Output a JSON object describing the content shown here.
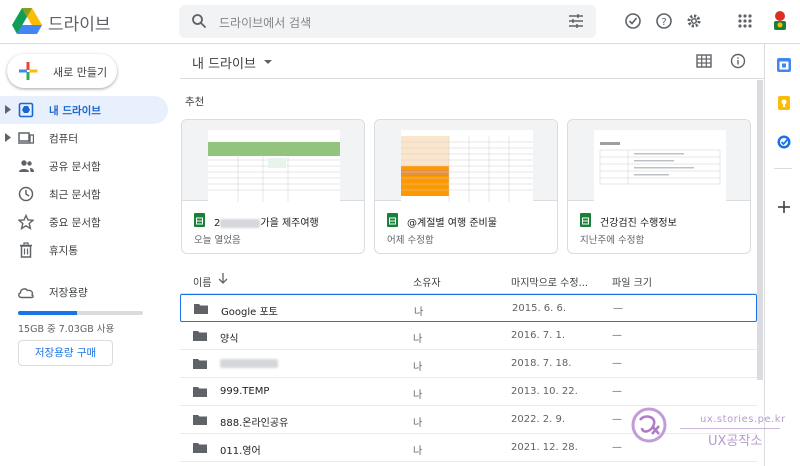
{
  "header": {
    "app_title": "드라이브",
    "search_placeholder": "드라이브에서 검색",
    "icons": [
      "search-icon",
      "tune-icon",
      "offline-check-icon",
      "help-icon",
      "settings-icon",
      "apps-grid-icon",
      "account-avatar"
    ]
  },
  "sidebar": {
    "new_button": "새로 만들기",
    "items": [
      {
        "label": "내 드라이브",
        "icon": "my-drive-icon",
        "active": true,
        "expandable": true
      },
      {
        "label": "컴퓨터",
        "icon": "computer-icon",
        "active": false,
        "expandable": true
      },
      {
        "label": "공유 문서함",
        "icon": "shared-people-icon",
        "active": false,
        "expandable": false
      },
      {
        "label": "최근 문서함",
        "icon": "clock-icon",
        "active": false,
        "expandable": false
      },
      {
        "label": "중요 문서함",
        "icon": "star-icon",
        "active": false,
        "expandable": false
      },
      {
        "label": "휴지통",
        "icon": "trash-icon",
        "active": false,
        "expandable": false
      }
    ],
    "storage": {
      "label": "저장용량",
      "usage_text": "15GB 중 7.03GB 사용",
      "used_fraction": 0.47,
      "buy_button": "저장용량 구매"
    }
  },
  "main": {
    "breadcrumb": "내 드라이브",
    "suggested_title": "추천",
    "cards": [
      {
        "name_prefix": "2",
        "name_suffix": "가을 제주여행",
        "meta": "오늘 열었음"
      },
      {
        "name_prefix": "@계절별 여행 준비물",
        "name_suffix": "",
        "meta": "어제 수정함"
      },
      {
        "name_prefix": "건강검진 수행정보",
        "name_suffix": "",
        "meta": "지난주에 수정함"
      }
    ],
    "columns": {
      "name": "이름",
      "owner": "소유자",
      "modified": "마지막으로 수정...",
      "size": "파일 크기"
    },
    "rows": [
      {
        "name": "Google 포토",
        "owner": "나",
        "modified": "2015. 6. 6.",
        "size": "—",
        "selected": true
      },
      {
        "name": "양식",
        "owner": "나",
        "modified": "2016. 7. 1.",
        "size": "—",
        "selected": false
      },
      {
        "name": "",
        "owner": "나",
        "modified": "2018. 7. 18.",
        "size": "—",
        "selected": false,
        "blurred": true
      },
      {
        "name": "999.TEMP",
        "owner": "나",
        "modified": "2013. 10. 22.",
        "size": "—",
        "selected": false
      },
      {
        "name": "888.온라인공유",
        "owner": "나",
        "modified": "2022. 2. 9.",
        "size": "—",
        "selected": false
      },
      {
        "name": "011.영어",
        "owner": "나",
        "modified": "2021. 12. 28.",
        "size": "—",
        "selected": false
      }
    ]
  },
  "watermark": {
    "url": "ux.stories.pe.kr",
    "name": "UX공작소"
  },
  "colors": {
    "accent": "#1a73e8",
    "active_bg": "#e8f0fe",
    "sheets_green": "#188038",
    "keep_yellow": "#fbbc04"
  }
}
